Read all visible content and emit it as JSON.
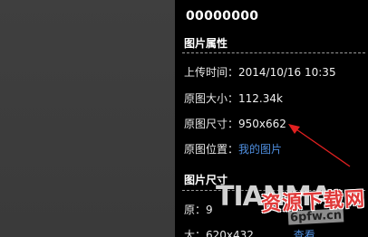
{
  "panel": {
    "file_name": "00000000",
    "properties_title": "图片属性",
    "upload_label": "上传时间：",
    "upload_value": "2014/10/16 10:35",
    "size_label": "原图大小：",
    "size_value": "112.34k",
    "dims_label": "原图尺寸：",
    "dims_value": "950x662",
    "location_label": "原图位置：",
    "location_value": "我的图片",
    "image_size_title": "图片尺寸",
    "sub_row1_prefix": "原：9",
    "sub_row2_prefix": "大：620x432",
    "sub_row2_link": "查看"
  },
  "watermark": {
    "latin": "TIANMA",
    "chinese": "资源下载网",
    "url": "6pfw.cn"
  },
  "colors": {
    "panel_bg": "#000000",
    "left_bg": "#3a3a3a",
    "link": "#4f8fe0",
    "arrow": "#e02020"
  },
  "icons": {
    "annotation": "red-arrow-icon"
  }
}
